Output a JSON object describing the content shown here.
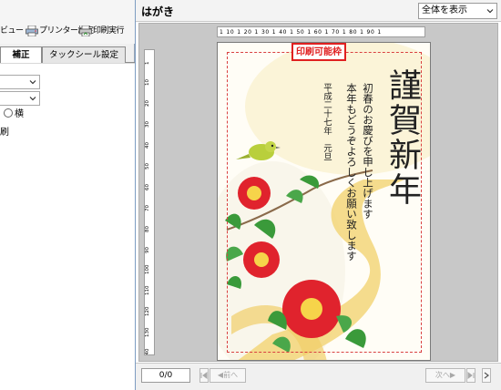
{
  "toolbar": {
    "preview_label": "ビュー",
    "printer_settings_label": "プリンター設定",
    "print_run_label": "印刷実行"
  },
  "left_tabs": [
    {
      "label": "補正",
      "active": true
    },
    {
      "label": "タックシール設定",
      "active": false
    }
  ],
  "options": {
    "orientation_landscape_label": "横",
    "print_label": "刷"
  },
  "header": {
    "title": "はがき",
    "zoom_value": "全体を表示"
  },
  "print_area_label": "印刷可能枠",
  "rulers": {
    "top_ticks": [
      "1",
      "10",
      "1",
      "20",
      "1",
      "30",
      "1",
      "40",
      "1",
      "50",
      "1",
      "60",
      "1",
      "70",
      "1",
      "80",
      "1",
      "90",
      "1"
    ],
    "left_ticks": [
      "1",
      "10",
      "20",
      "30",
      "40",
      "50",
      "60",
      "70",
      "80",
      "90",
      "100",
      "110",
      "120",
      "130",
      "140"
    ]
  },
  "card_text": {
    "main_greeting": "謹賀新年",
    "message_line1": "初春のお慶びを申し上げます",
    "message_line2": "本年もどうぞよろしくお願い致します",
    "date_line": "平成二十七年　元旦"
  },
  "pager": {
    "page_value": "0/0",
    "prev_label": "前へ",
    "next_label": "次へ"
  },
  "colors": {
    "accent_red": "#e02020",
    "background_blue": "#7d9dc2",
    "camellia_red": "#e0232d",
    "leaf_green": "#3a9a3a",
    "gold_path": "#f1cf6a"
  }
}
